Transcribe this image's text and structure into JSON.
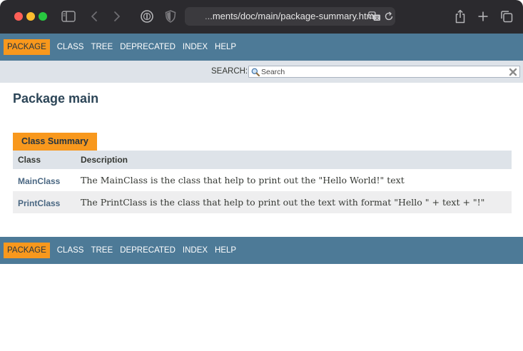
{
  "browser": {
    "url": "...ments/doc/main/package-summary.html"
  },
  "nav": {
    "items": [
      {
        "label": "Package",
        "active": true
      },
      {
        "label": "Class",
        "active": false
      },
      {
        "label": "Tree",
        "active": false
      },
      {
        "label": "Deprecated",
        "active": false
      },
      {
        "label": "Index",
        "active": false
      },
      {
        "label": "Help",
        "active": false
      }
    ]
  },
  "search": {
    "label": "SEARCH:",
    "placeholder": "Search"
  },
  "page": {
    "title": "Package main"
  },
  "summary": {
    "caption": "Class Summary",
    "headers": [
      "Class",
      "Description"
    ],
    "rows": [
      {
        "name": "MainClass",
        "description": "The MainClass is the class that help to print out the \"Hello World!\" text"
      },
      {
        "name": "PrintClass",
        "description": "The PrintClass is the class that help to print out the text with format \"Hello \" + text + \"!\""
      }
    ]
  },
  "colors": {
    "navbar": "#4d7a97",
    "accent": "#f8981d",
    "subnav": "#dee3e9",
    "link": "#4a6782"
  }
}
